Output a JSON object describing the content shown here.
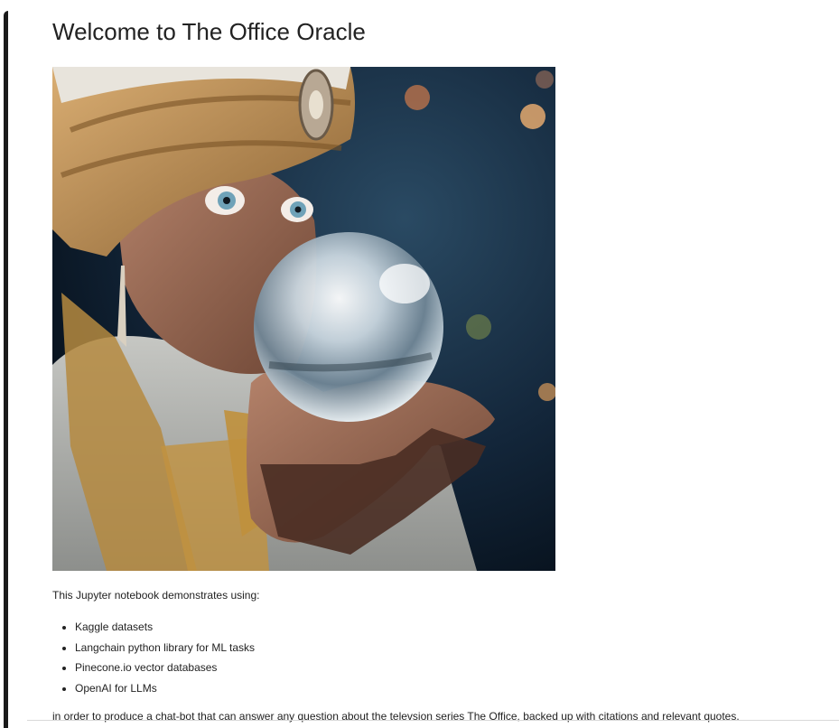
{
  "notebook": {
    "title": "Welcome to The Office Oracle",
    "hero_image": {
      "depicts": "fortune-teller in turban gazing into crystal ball"
    },
    "intro": "This Jupyter notebook demonstrates using:",
    "features": [
      {
        "label": "Kaggle datasets"
      },
      {
        "label": "Langchain python library for ML tasks"
      },
      {
        "label": "Pinecone.io vector databases"
      },
      {
        "label": "OpenAI for LLMs"
      }
    ],
    "outro": "in order to produce a chat-bot that can answer any question about the televsion series The Office, backed up with citations and relevant quotes."
  },
  "colors": {
    "cell_border": "#1a1a1a",
    "text": "#222222",
    "background": "#ffffff"
  }
}
